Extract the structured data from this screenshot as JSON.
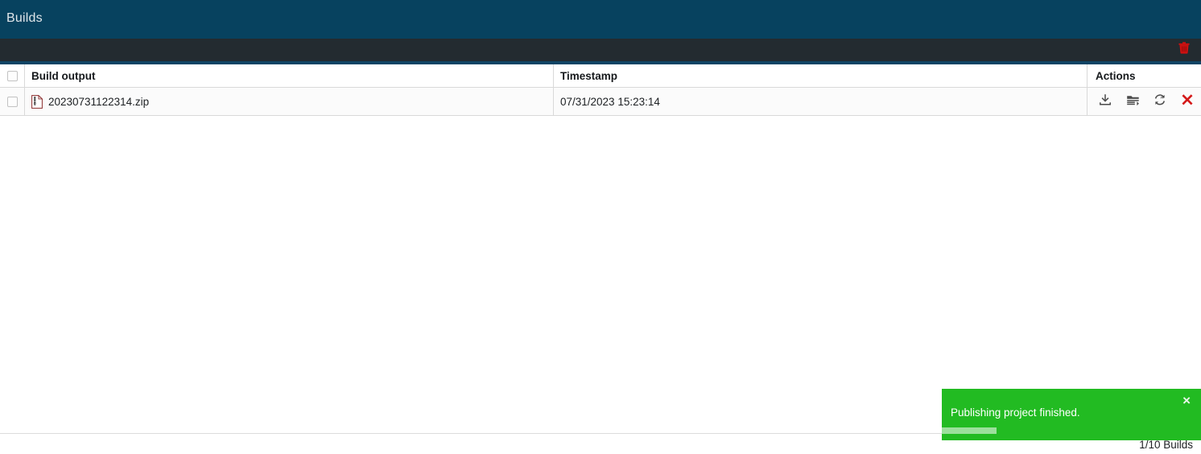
{
  "header": {
    "title": "Builds"
  },
  "toolbar": {
    "delete_label": "Delete selected builds",
    "delete_icon": "trash-icon",
    "accent_color": "#0f4465",
    "bg_color": "#232b30"
  },
  "table": {
    "columns": [
      {
        "key": "select",
        "label": ""
      },
      {
        "key": "name",
        "label": "Build output"
      },
      {
        "key": "timestamp",
        "label": "Timestamp"
      },
      {
        "key": "actions",
        "label": "Actions"
      }
    ],
    "select_all_checked": false,
    "rows": [
      {
        "selected": false,
        "file_icon": "zip-file-icon",
        "name": "20230731122314.zip",
        "timestamp": "07/31/2023 15:23:14",
        "actions": [
          {
            "name": "download-icon",
            "label": "Download"
          },
          {
            "name": "deploy-icon",
            "label": "Deploy"
          },
          {
            "name": "redeploy-icon",
            "label": "Redeploy"
          },
          {
            "name": "delete-icon",
            "label": "Delete"
          }
        ]
      }
    ]
  },
  "footer": {
    "count_label": "1/10 Builds"
  },
  "toast": {
    "message": "Publishing project finished.",
    "close_label": "×",
    "background_color": "#22bb22",
    "progress_color": "#9ce09c",
    "progress_percent": 21
  }
}
